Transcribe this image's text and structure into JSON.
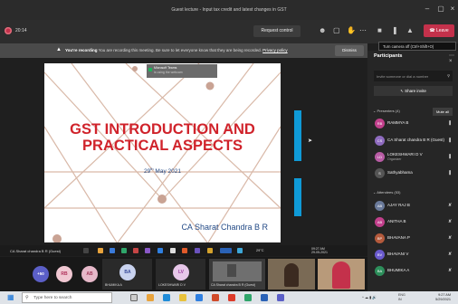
{
  "window": {
    "title": "Guest lecture - Input tax credit and latest changes in GST"
  },
  "toolbar": {
    "timer": "20:14",
    "request_control": "Request control",
    "leave": "Leave",
    "camera_tooltip": "Turn camera off (Ctrl+Shift+O)"
  },
  "banner": {
    "bold": "You're recording",
    "message": "You are recording this meeting. Be sure to let everyone know that they are being recorded.",
    "link": "Privacy policy",
    "dismiss": "Dismiss"
  },
  "slide": {
    "title_line1": "GST INTRODUCTION AND",
    "title_line2": "PRACTICAL ASPECTS",
    "date_day": "29",
    "date_suffix": "th",
    "date_rest": "May 2021",
    "author": "CA Sharat Chandra B R",
    "toast_title": "Microsoft Teams",
    "toast_sub": "is using the webcam"
  },
  "sharebar": {
    "presenter": "CA Sharat chandra B R (Guest)",
    "temp": "29°C",
    "time": "09:27 AM",
    "date": "29-05-2021"
  },
  "participants": {
    "title": "Participants",
    "invite_placeholder": "Invite someone or dial a number",
    "share_invite": "Share invite",
    "presenters_label": "Presenters (4)",
    "mute_all": "Mute all",
    "attendees_label": "Attendees (53)",
    "presenters": [
      {
        "name": "RAMMYA B",
        "initials": "RB",
        "color": "#c2408c",
        "role": ""
      },
      {
        "name": "CA Sharat chandra B R (Guest)",
        "initials": "CS",
        "color": "#8e6bbf",
        "role": ""
      },
      {
        "name": "LOKESHWARI D V",
        "initials": "LD",
        "color": "#b95ca5",
        "role": "Organizer"
      },
      {
        "name": "Sathyabhama",
        "initials": "S",
        "color": "#555555",
        "role": ""
      }
    ],
    "attendees": [
      {
        "name": "AJAY RAJ B",
        "initials": "AB",
        "color": "#6a7a9a"
      },
      {
        "name": "ANITHA B",
        "initials": "AB",
        "color": "#c2408c"
      },
      {
        "name": "BHAVANA P",
        "initials": "BP",
        "color": "#b45a3c"
      },
      {
        "name": "BHAVANI V",
        "initials": "BV",
        "color": "#6a5acd"
      },
      {
        "name": "BHUMIKA A",
        "initials": "BA",
        "color": "#2d8f5b"
      }
    ]
  },
  "strip": {
    "count_badge": "+50",
    "tiles": [
      {
        "initials": "RB",
        "color": "#f0c7d2",
        "text": "#b0305a"
      },
      {
        "initials": "AB",
        "color": "#e6b8c9",
        "text": "#a03a5a"
      },
      {
        "initials": "BA",
        "color": "#c9d3ef",
        "text": "#3a4c9a",
        "label": "BHUMIKA A"
      },
      {
        "initials": "LV",
        "color": "#e7c7e9",
        "text": "#9a3aa0",
        "label": "LOKESHWARI D V"
      }
    ],
    "video_label": "CA Sharat chandra B R (Guest)"
  },
  "taskbar": {
    "search_placeholder": "Type here to search",
    "lang": "ENG",
    "region": "IN",
    "time": "9:27 AM",
    "date": "5/29/2021"
  }
}
